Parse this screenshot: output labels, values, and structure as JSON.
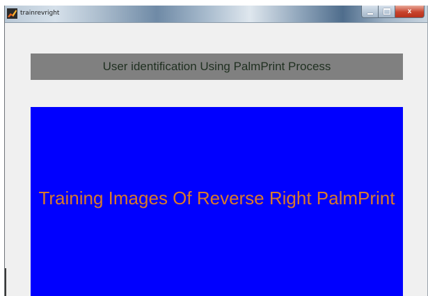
{
  "window": {
    "title": "trainrevright",
    "app_icon": "matlab-figure-icon",
    "controls": {
      "minimize": "minimize-icon",
      "maximize": "maximize-icon",
      "close": "close-icon",
      "close_glyph": "x"
    }
  },
  "main": {
    "header_text": "User identification Using PalmPrint Process",
    "panel_text": "Training Images Of Reverse Right PalmPrint"
  },
  "colors": {
    "window_bg": "#f0f0f0",
    "header_bg": "#808080",
    "header_text": "#1f2f20",
    "panel_bg": "#0000ff",
    "panel_text": "#d97a2b"
  }
}
